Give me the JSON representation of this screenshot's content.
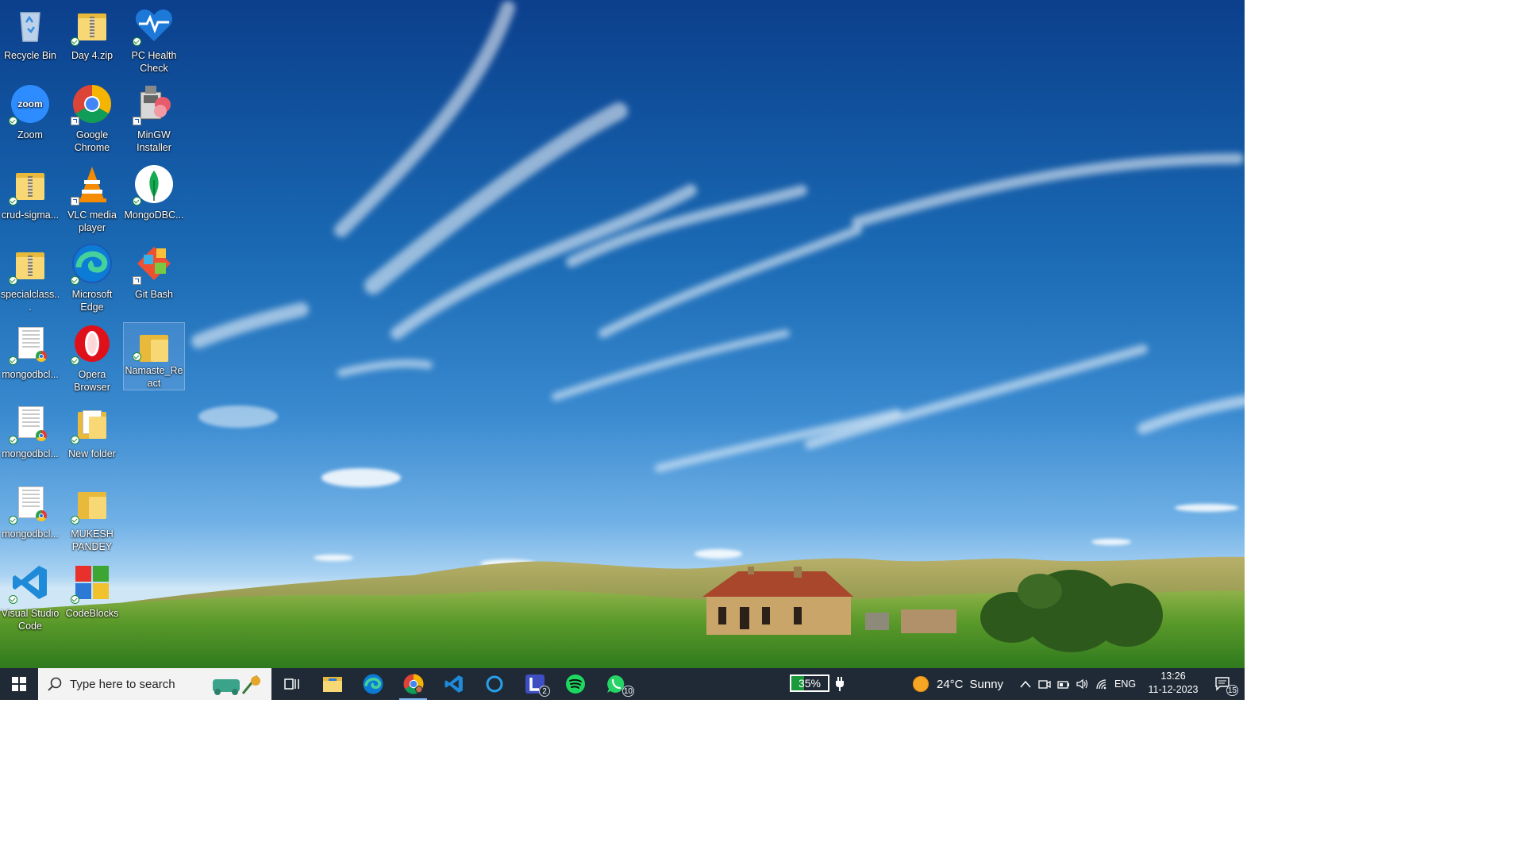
{
  "desktop": {
    "icons": [
      {
        "label": "Recycle Bin",
        "icon": "recycle-bin-icon"
      },
      {
        "label": "Day 4.zip",
        "icon": "zip-folder-icon"
      },
      {
        "label": "PC Health Check",
        "icon": "pc-health-check-icon"
      },
      {
        "label": "Zoom",
        "icon": "zoom-icon"
      },
      {
        "label": "Google Chrome",
        "icon": "chrome-icon"
      },
      {
        "label": "MinGW Installer",
        "icon": "mingw-installer-icon"
      },
      {
        "label": "crud-sigma...",
        "icon": "zip-folder-icon"
      },
      {
        "label": "VLC media player",
        "icon": "vlc-icon"
      },
      {
        "label": "MongoDBC...",
        "icon": "mongodb-compass-icon"
      },
      {
        "label": "specialclass...",
        "icon": "zip-folder-icon"
      },
      {
        "label": "Microsoft Edge",
        "icon": "edge-icon"
      },
      {
        "label": "Git Bash",
        "icon": "git-bash-icon"
      },
      {
        "label": "mongodbcl...",
        "icon": "html-document-icon"
      },
      {
        "label": "Opera Browser",
        "icon": "opera-icon"
      },
      {
        "label": "Namaste_React",
        "icon": "folder-icon"
      },
      {
        "label": "mongodbcl...",
        "icon": "html-document-icon"
      },
      {
        "label": "New folder",
        "icon": "folder-icon"
      },
      {
        "label": "mongodbcl...",
        "icon": "html-document-icon"
      },
      {
        "label": "MUKESH PANDEY",
        "icon": "folder-icon"
      },
      {
        "label": "Visual Studio Code",
        "icon": "vscode-icon"
      },
      {
        "label": "CodeBlocks",
        "icon": "codeblocks-icon"
      }
    ]
  },
  "taskbar": {
    "search_placeholder": "Type here to search",
    "pinned": [
      {
        "icon": "task-view-icon"
      },
      {
        "icon": "file-explorer-icon"
      },
      {
        "icon": "edge-icon"
      },
      {
        "icon": "chrome-icon",
        "active": true
      },
      {
        "icon": "vscode-icon"
      },
      {
        "icon": "cortana-icon"
      },
      {
        "icon": "lens-icon",
        "badge": "2"
      },
      {
        "icon": "spotify-icon"
      },
      {
        "icon": "whatsapp-icon",
        "badge": "10"
      }
    ],
    "battery_percent": 35,
    "battery_text": "35%",
    "weather": {
      "temp": "24°C",
      "condition": "Sunny"
    },
    "language": "ENG",
    "time": "13:26",
    "date": "11-12-2023",
    "notification_count": "15"
  }
}
